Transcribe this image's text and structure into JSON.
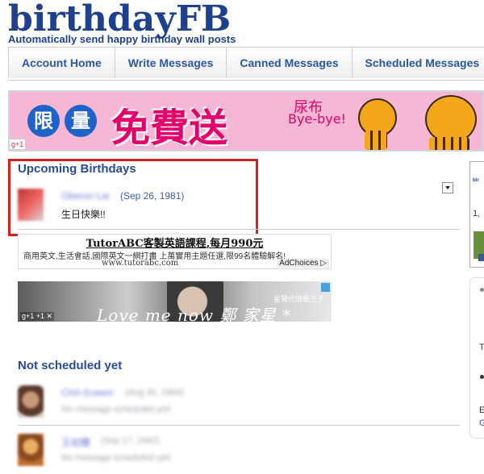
{
  "header": {
    "logo": "birthdayFB",
    "tagline": "Automatically send happy birthday wall posts"
  },
  "nav": {
    "tabs": [
      "Account Home",
      "Write Messages",
      "Canned Messages",
      "Scheduled Messages"
    ]
  },
  "banner": {
    "circle1": "限",
    "circle2": "量",
    "headline": "免費送",
    "bye_top": "尿布",
    "bye": "Bye-bye!",
    "gplus": "g+1"
  },
  "upcoming": {
    "title": "Upcoming Birthdays",
    "items": [
      {
        "name": "Oberon Lai",
        "date": "(Sep 26, 1981)",
        "message": "生日快樂!!"
      }
    ]
  },
  "ad_text": {
    "title": "TutorABC客製英語課程,每月990元",
    "desc": "商用英文,生活會話,國際英文一網打盡 上萬實用主題任選,限99名體驗解名!",
    "url": "www.tutorabc.com",
    "adchoices": "AdChoices ▷"
  },
  "ad_image": {
    "love": "Love me now 鄭 家星 * Carlson",
    "small": "星聲代情歌王子",
    "gplus": "g+1  +1  ✕"
  },
  "not_scheduled": {
    "title": "Not scheduled yet",
    "items": [
      {
        "name": "Chin Euwen",
        "date": "(Aug 30, 1983)",
        "message": "No message scheduled yet!"
      },
      {
        "name": "王如蘭",
        "date": "(Sep 17, 1992)",
        "message": "No message scheduled yet!"
      }
    ]
  },
  "right_column": {
    "t1": "bir",
    "t2": "1,",
    "t3": "T",
    "t4": "E",
    "t5": "G"
  },
  "colors": {
    "brand": "#1f3f8f",
    "highlight": "#d42020",
    "banner_pink": "#f6b7d4"
  }
}
